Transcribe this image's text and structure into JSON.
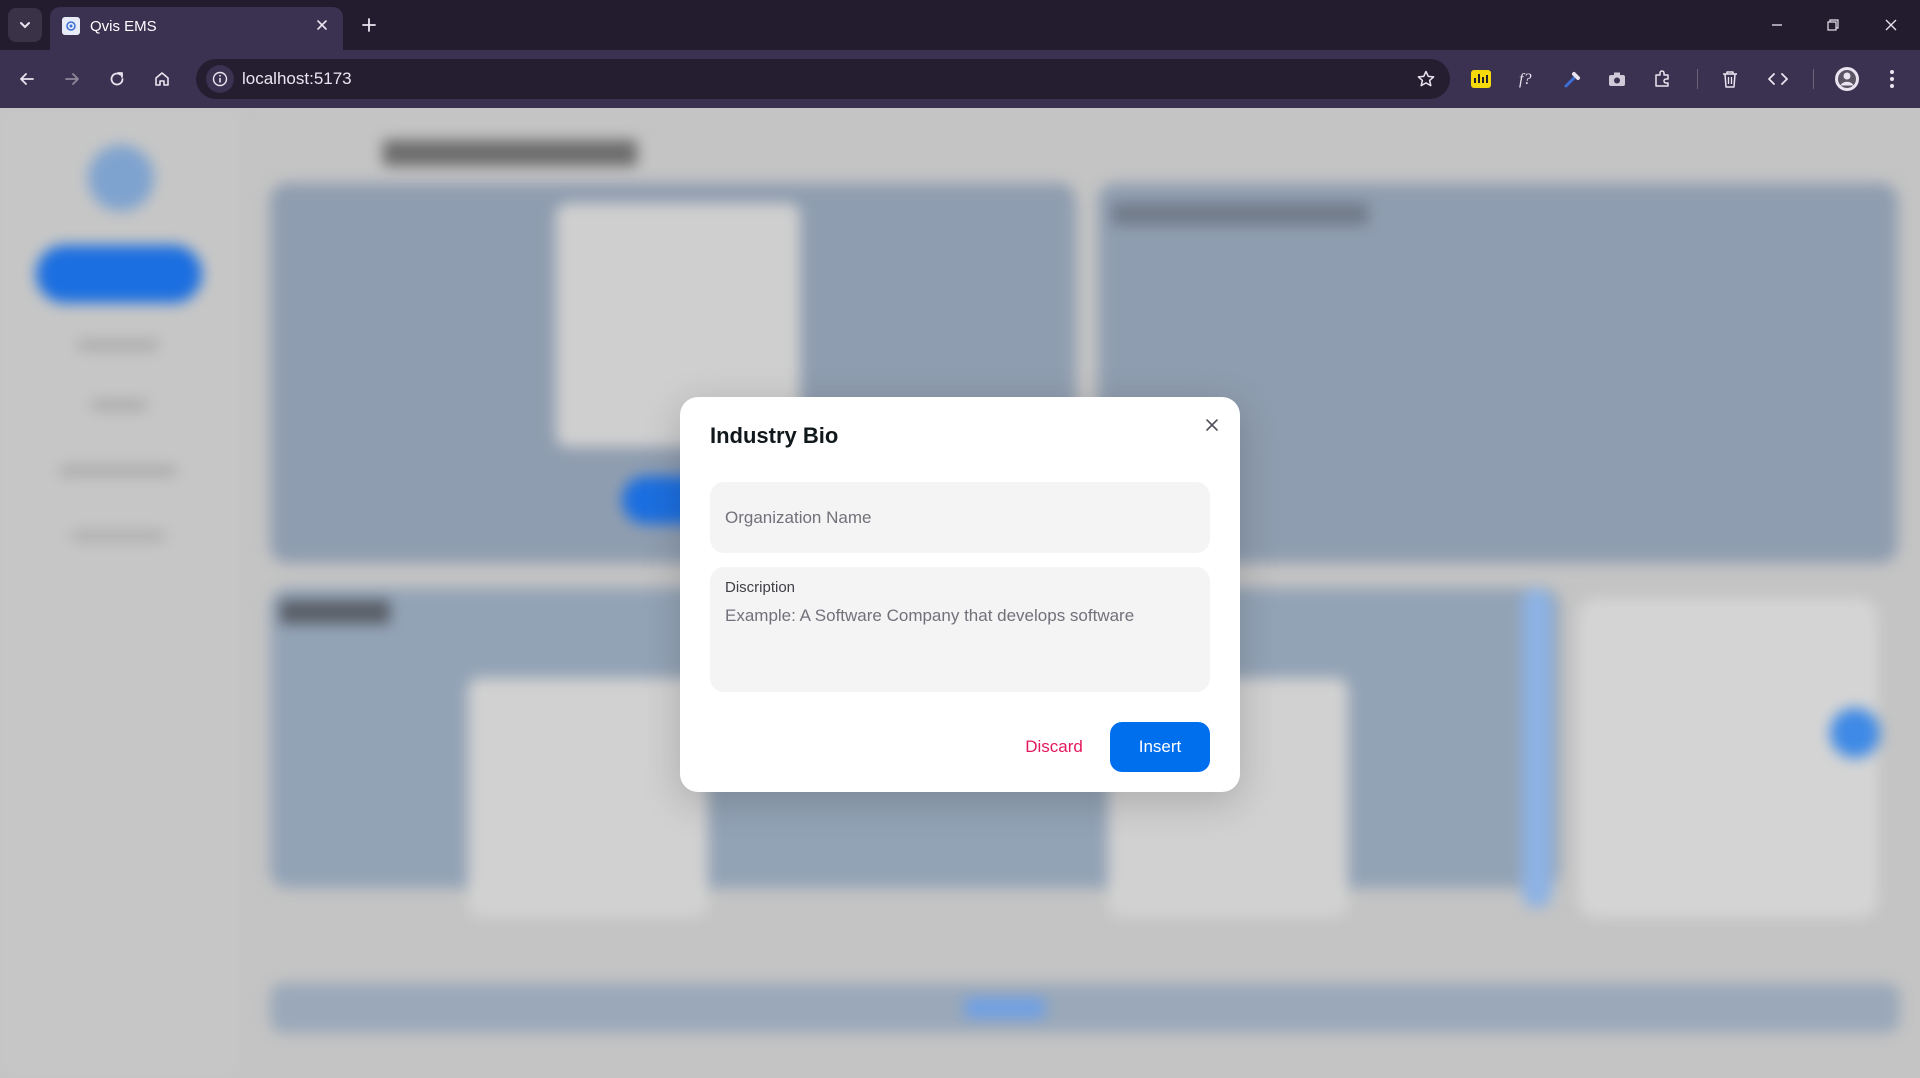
{
  "browser": {
    "tab_title": "Qvis EMS",
    "url": "localhost:5173",
    "icons": {
      "tab_list": "chevron-down-icon",
      "tab_close": "close-icon",
      "new_tab": "plus-icon",
      "back": "arrow-left-icon",
      "forward": "arrow-right-icon",
      "reload": "reload-icon",
      "home": "home-icon",
      "site_info": "info-icon",
      "bookmark": "star-icon",
      "extensions": [
        "chart-extension-icon",
        "font-extension-icon",
        "eyedropper-extension-icon",
        "camera-extension-icon",
        "puzzle-icon",
        "trash-icon",
        "code-icon",
        "profile-avatar",
        "kebab-menu-icon"
      ],
      "window": [
        "minimize-icon",
        "restore-icon",
        "close-window-icon"
      ]
    }
  },
  "modal": {
    "title": "Industry Bio",
    "org_placeholder": "Organization Name",
    "description_label": "Discription",
    "description_placeholder": "Example: A Software Company that develops software",
    "discard_label": "Discard",
    "insert_label": "Insert"
  },
  "colors": {
    "primary": "#006fee",
    "danger": "#e3195f",
    "chrome_dark": "#231c2e",
    "chrome_toolbar": "#3b3150"
  }
}
